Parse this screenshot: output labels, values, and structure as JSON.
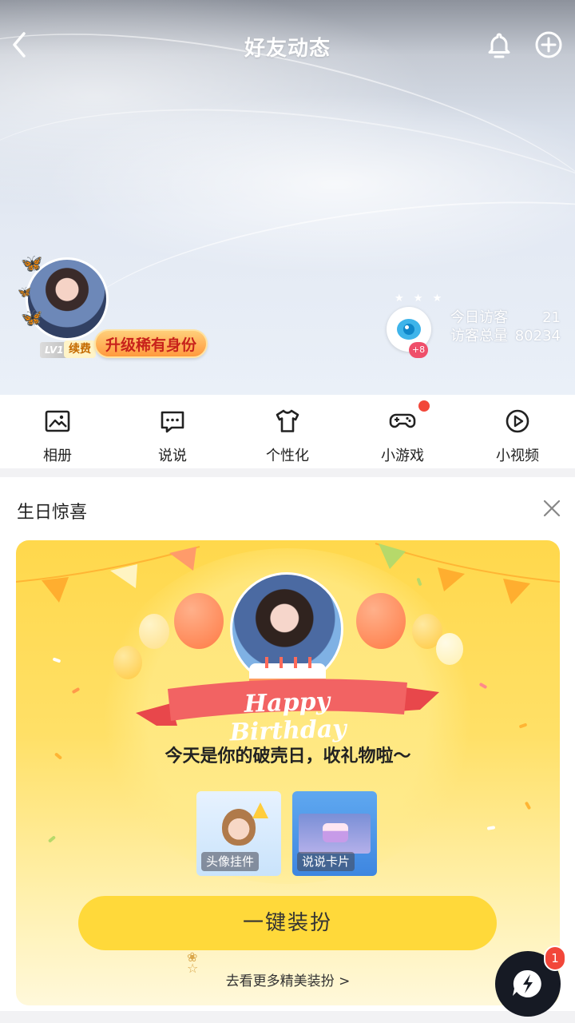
{
  "header": {
    "title": "好友动态",
    "back_icon": "chevron-left-icon",
    "bell_icon": "bell-icon",
    "add_icon": "plus-circle-icon"
  },
  "profile": {
    "level": "LV1",
    "renew": "续费",
    "upgrade": "升级稀有身份"
  },
  "visitors": {
    "badge": "+8",
    "today_label": "今日访客",
    "today_value": "21",
    "total_label": "访客总量",
    "total_value": "80234"
  },
  "quick_nav": [
    {
      "label": "相册",
      "icon": "photo-icon"
    },
    {
      "label": "说说",
      "icon": "chat-bubble-icon"
    },
    {
      "label": "个性化",
      "icon": "shirt-icon"
    },
    {
      "label": "小游戏",
      "icon": "gamepad-icon",
      "has_dot": true
    },
    {
      "label": "小视频",
      "icon": "play-circle-icon"
    }
  ],
  "birthday_card": {
    "title": "生日惊喜",
    "script": "Happy Birthday",
    "message": "今天是你的破壳日，收礼物啦～",
    "gifts": [
      {
        "label": "头像挂件"
      },
      {
        "label": "说说卡片"
      }
    ],
    "dress_button": "一键装扮",
    "more_link": "去看更多精美装扮 >"
  },
  "fab": {
    "icon": "lightning-chat-icon",
    "badge": "1"
  },
  "colors": {
    "accent_yellow": "#ffd93a",
    "badge_red": "#f2473a",
    "eye_blue": "#3eb4ea",
    "fab_dark": "#161a24"
  }
}
